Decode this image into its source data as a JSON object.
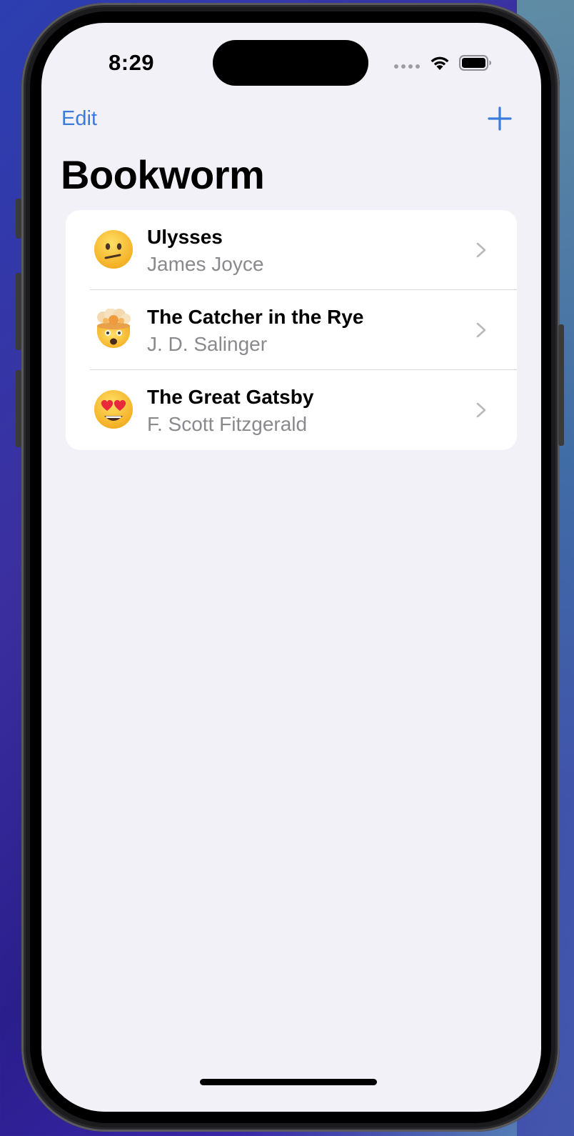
{
  "status_bar": {
    "time": "8:29",
    "icons": [
      "cellular-signal-icon",
      "wifi-icon",
      "battery-icon"
    ]
  },
  "nav": {
    "edit_label": "Edit",
    "add_icon": "plus-icon",
    "title": "Bookworm"
  },
  "books": [
    {
      "title": "Ulysses",
      "author": "James Joyce",
      "rating_emoji": "neutral-face-icon"
    },
    {
      "title": "The Catcher in the Rye",
      "author": "J. D. Salinger",
      "rating_emoji": "exploding-head-icon"
    },
    {
      "title": "The Great Gatsby",
      "author": "F. Scott Fitzgerald",
      "rating_emoji": "heart-eyes-face-icon"
    }
  ],
  "colors": {
    "accent": "#3a7bdc",
    "background": "#f2f1f7",
    "secondary_text": "#8a8a8e"
  }
}
